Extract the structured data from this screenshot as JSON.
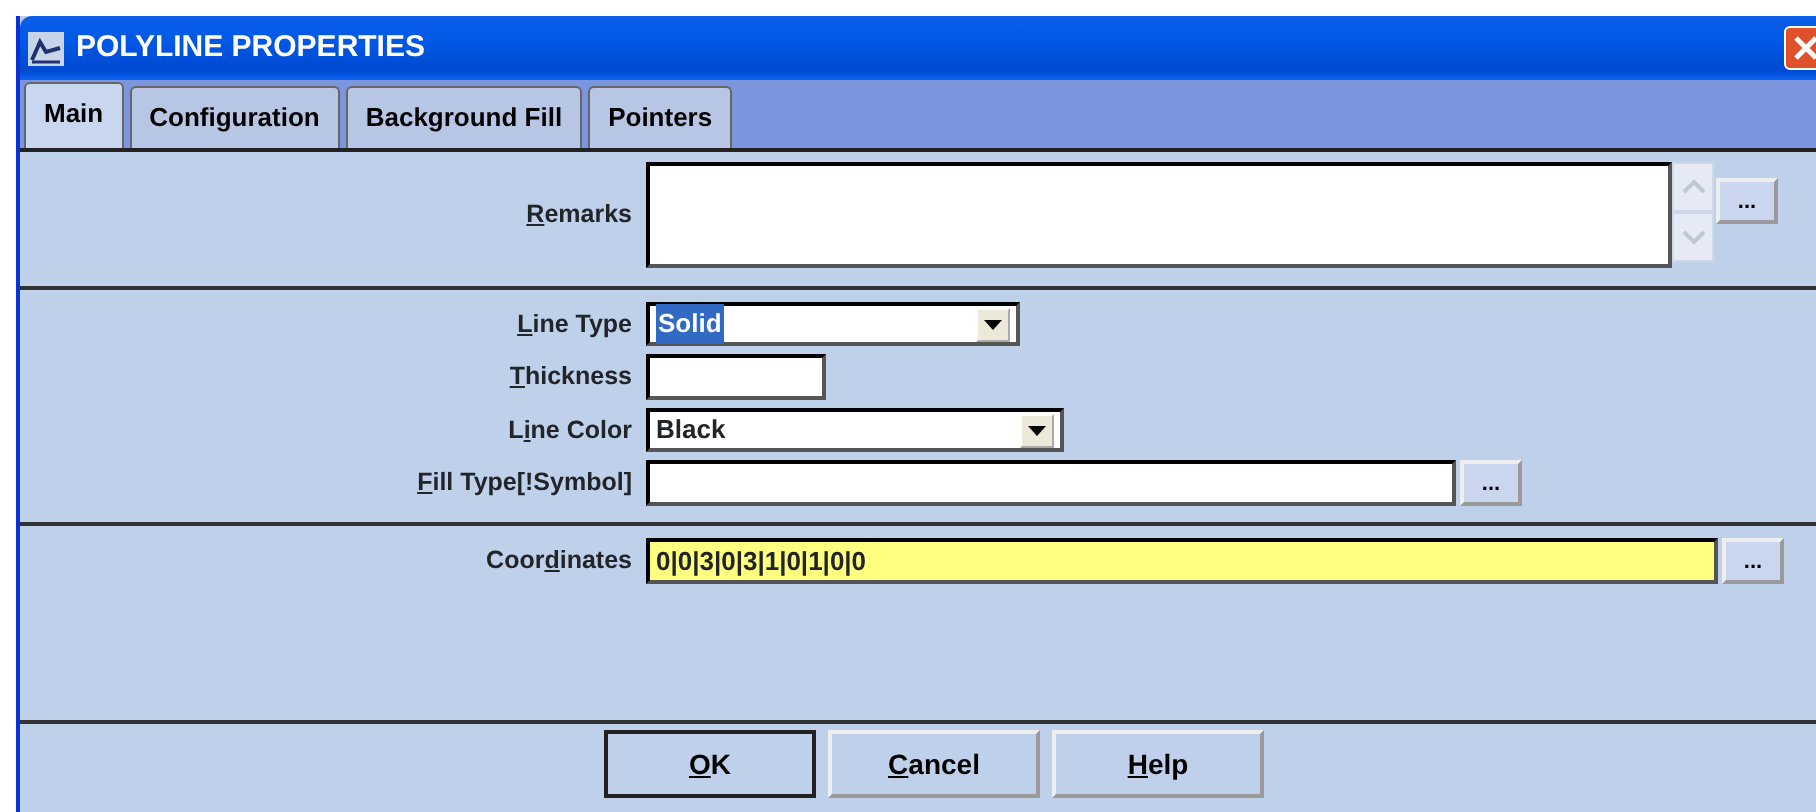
{
  "window": {
    "title": "POLYLINE PROPERTIES"
  },
  "tabs": [
    {
      "label": "Main",
      "selected": true
    },
    {
      "label": "Configuration",
      "selected": false
    },
    {
      "label": "Background Fill",
      "selected": false
    },
    {
      "label": "Pointers",
      "selected": false
    }
  ],
  "remarks": {
    "label": {
      "key": "R",
      "post": "emarks"
    },
    "browse": "..."
  },
  "fields": [
    {
      "kind": "select",
      "label": {
        "key": "L",
        "post": "ine Type"
      },
      "value": "Solid",
      "highlighted": true
    },
    {
      "kind": "text",
      "label": {
        "key": "T",
        "post": "hickness"
      }
    },
    {
      "kind": "select",
      "label": {
        "pre": "L",
        "key": "i",
        "post": "ne Color"
      },
      "value": "Black",
      "highlighted": false
    },
    {
      "kind": "browse",
      "label": {
        "key": "F",
        "post": "ill Type[!Symbol]"
      },
      "browse": "..."
    }
  ],
  "coordinates": {
    "label": {
      "pre": "Coor",
      "key": "d",
      "post": "inates"
    },
    "value": "0|0|3|0|3|1|0|1|0|0",
    "browse": "..."
  },
  "buttons": [
    {
      "label": {
        "key": "O",
        "post": "K"
      }
    },
    {
      "label": {
        "key": "C",
        "post": "ancel"
      }
    },
    {
      "label": {
        "key": "H",
        "post": "elp"
      }
    }
  ]
}
